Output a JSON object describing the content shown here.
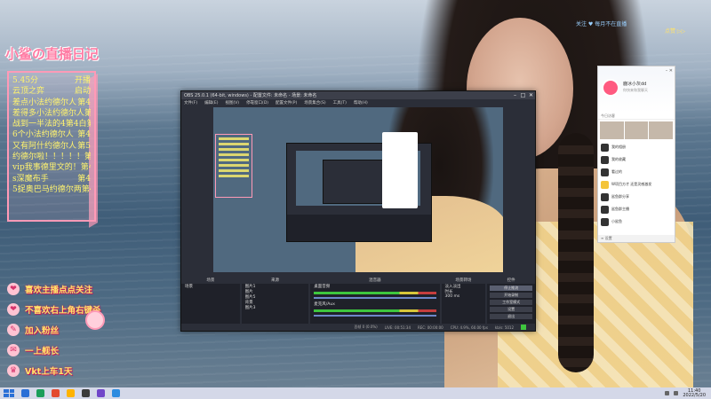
{
  "overlay": {
    "diary_title": "小鲨の直播日记",
    "diary_rows": [
      {
        "left": "5.45分",
        "right": "开播"
      },
      {
        "left": "云顶之弈",
        "right": "启动"
      },
      {
        "left": "差点小法约德尔人",
        "right": "第4"
      },
      {
        "left": "差得多小法约德尔人",
        "right": "第4"
      },
      {
        "left": "战到一半法的4第4白",
        "right": "第6"
      },
      {
        "left": "6个小法约德尔人",
        "right": "第4"
      },
      {
        "left": "又有阿什约德尔人",
        "right": "第5"
      },
      {
        "left": "约德尔啦！！！！！",
        "right": "第5"
      },
      {
        "left": "vip我事德里文的！",
        "right": "第4"
      },
      {
        "left": "s深魔布手",
        "right": "第4"
      },
      {
        "left": "5捉奥巴马约德尔两",
        "right": "第4"
      }
    ],
    "rules": [
      {
        "icon": "❤",
        "text": "喜欢主播点点关注"
      },
      {
        "icon": "❤",
        "text": "不喜欢右上角右键杀"
      },
      {
        "icon": "✎",
        "text": "加入粉丝"
      },
      {
        "icon": "✉",
        "text": "一上舰长"
      },
      {
        "icon": "♛",
        "text": "Vkt上车1天"
      }
    ],
    "top_right_text": "关注 ♥ 每月不在直播",
    "top_right_btn": "点赞 ▷▷"
  },
  "obs": {
    "title": "OBS 25.0.1 (64-bit, windows) - 配置文件: 未命名 - 场景: 未命名",
    "window_controls": [
      "–",
      "□",
      "✕"
    ],
    "menu": [
      "文件(F)",
      "编辑(E)",
      "视图(V)",
      "停靠窗口(D)",
      "配置文件(P)",
      "场景集合(S)",
      "工具(T)",
      "帮助(H)"
    ],
    "docks": {
      "scenes": {
        "title": "场景",
        "items": [
          "场景"
        ]
      },
      "sources": {
        "title": "来源",
        "items": [
          "图片1",
          "图片",
          "图片5",
          "背景",
          "图片3"
        ]
      },
      "mixer": {
        "title": "混音器",
        "items": [
          "桌面音频",
          "麦克风/Aux"
        ]
      },
      "transitions": {
        "title": "场景转场",
        "type": "淡入淡出",
        "duration_label": "时长",
        "duration": "300 ms"
      },
      "controls": {
        "title": "控件",
        "buttons": [
          "停止推流",
          "开始录制",
          "工作室模式",
          "设置",
          "退出"
        ]
      }
    },
    "status": {
      "dropped": "丢帧 0 (0.0%)",
      "live": "LIVE: 00:51:34",
      "rec": "REC: 00:00:00",
      "cpu": "CPU: 4.9%, 60.00 fps",
      "bitrate": "kb/s: 5012"
    }
  },
  "chat": {
    "name": "鹿冰小灰dd",
    "sub": "你快来和我聊天",
    "window_controls": [
      "–",
      "✕"
    ],
    "tabs": "今日访客",
    "list": [
      {
        "name": "我的相册",
        "color": "dark"
      },
      {
        "name": "我的收藏",
        "color": "dark"
      },
      {
        "name": "看过的",
        "color": "dark"
      },
      {
        "name": "W项目方才 还是灵感激发",
        "color": "yellow"
      },
      {
        "name": "鲨鱼群分享",
        "color": "dark"
      },
      {
        "name": "鲨鱼群主播",
        "color": "dark"
      },
      {
        "name": "小鲨鱼",
        "color": "dark"
      }
    ],
    "bottom": "≡ 设置"
  },
  "taskbar": {
    "time": "11:40",
    "date": "2022/5/20",
    "icons": [
      "#2a6fd6",
      "#1b9e5a",
      "#e34a2f",
      "#ffb300",
      "#3b3b3b",
      "#7046c9",
      "#2c8be0"
    ]
  }
}
